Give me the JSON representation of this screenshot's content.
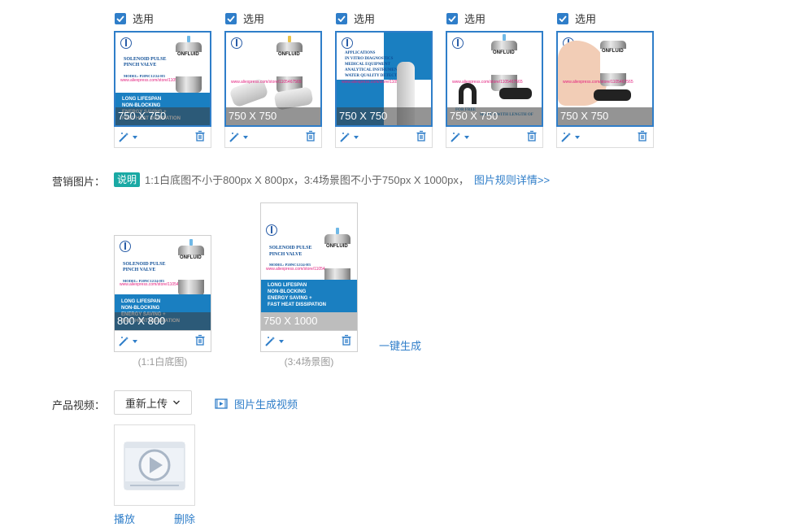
{
  "selected_images": [
    {
      "select_label": "选用",
      "size": "750 X 750",
      "variant": "info"
    },
    {
      "select_label": "选用",
      "size": "750 X 750",
      "variant": "tubes"
    },
    {
      "select_label": "选用",
      "size": "750 X 750",
      "variant": "applications"
    },
    {
      "select_label": "选用",
      "size": "750 X 750",
      "variant": "clamp"
    },
    {
      "select_label": "选用",
      "size": "750 X 750",
      "variant": "hand"
    }
  ],
  "thumb_text": {
    "heading_1": "SOLENOID PULSE",
    "heading_2": "PINCH VALVE",
    "model": "MODEL: P20NC12/24-H3",
    "url": "www.aliexpress.com/store/1105467565",
    "blue_1": "LONG LIFESPAN",
    "blue_2": "NON-BLOCKING",
    "blue_3": "ENERGY SAVING +",
    "blue_4": "FAST HEAT DISSIPATION",
    "brand": "ONFLUID",
    "apps_1": "APPLICATIONS",
    "apps_2": "IN VITRO DIAGNOSTICS",
    "apps_3": "MEDICAL EQUIPMENT",
    "apps_4": "ANALYTICAL INSTRUMENTS",
    "apps_5": "WATER QUALITY DETECTION",
    "clamp_1": "FOR FREE",
    "clamp_2": "SELECT WITH LENGTH OF"
  },
  "marketing": {
    "label": "营销图片：",
    "badge": "说明",
    "hint": "1:1白底图不小于800px X 800px，3:4场景图不小于750px X 1000px，",
    "rules_link": "图片规则详情>>",
    "items": [
      {
        "size": "800 X 800",
        "caption": "(1:1白底图)"
      },
      {
        "size": "750 X 1000",
        "caption": "(3:4场景图)"
      }
    ],
    "generate_link": "一键生成"
  },
  "video": {
    "label": "产品视频：",
    "reupload": "重新上传",
    "generate_link": "图片生成视频",
    "play": "播放",
    "delete": "删除"
  },
  "colors": {
    "accent": "#2f7ec9",
    "badge": "#1aa9a4",
    "panel": "#1a7fc1"
  }
}
